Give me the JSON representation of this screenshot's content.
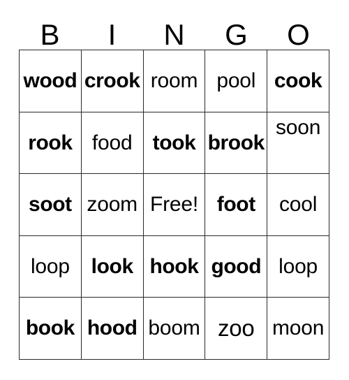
{
  "card": {
    "title": "BINGO card",
    "header_letters": [
      "B",
      "I",
      "N",
      "G",
      "O"
    ],
    "grid_line_color": "#2a2a2a",
    "background_color": "#ffffff",
    "text_color": "#000000",
    "rows": 5,
    "columns": 5,
    "free_space_label": "Free!",
    "cells": [
      [
        {
          "text": "wood",
          "bold": true,
          "align": "center"
        },
        {
          "text": "crook",
          "bold": true,
          "align": "center"
        },
        {
          "text": "room",
          "bold": false,
          "align": "center"
        },
        {
          "text": "pool",
          "bold": false,
          "align": "center"
        },
        {
          "text": "cook",
          "bold": true,
          "align": "center"
        }
      ],
      [
        {
          "text": "rook",
          "bold": true,
          "align": "center"
        },
        {
          "text": "food",
          "bold": false,
          "align": "center"
        },
        {
          "text": "took",
          "bold": true,
          "align": "center"
        },
        {
          "text": "brook",
          "bold": true,
          "align": "center"
        },
        {
          "text": "soon",
          "bold": false,
          "align": "top"
        }
      ],
      [
        {
          "text": "soot",
          "bold": true,
          "align": "center"
        },
        {
          "text": "zoom",
          "bold": false,
          "align": "center"
        },
        {
          "text": "Free!",
          "bold": false,
          "align": "center"
        },
        {
          "text": "foot",
          "bold": true,
          "align": "center"
        },
        {
          "text": "cool",
          "bold": false,
          "align": "center"
        }
      ],
      [
        {
          "text": "loop",
          "bold": false,
          "align": "center"
        },
        {
          "text": "look",
          "bold": true,
          "align": "center"
        },
        {
          "text": "hook",
          "bold": true,
          "align": "center"
        },
        {
          "text": "good",
          "bold": true,
          "align": "center"
        },
        {
          "text": "loop",
          "bold": false,
          "align": "center"
        }
      ],
      [
        {
          "text": "book",
          "bold": true,
          "align": "center"
        },
        {
          "text": "hood",
          "bold": true,
          "align": "center"
        },
        {
          "text": "boom",
          "bold": false,
          "align": "center"
        },
        {
          "text": "zoo",
          "bold": false,
          "align": "center",
          "short": true
        },
        {
          "text": "moon",
          "bold": false,
          "align": "center"
        }
      ]
    ]
  }
}
